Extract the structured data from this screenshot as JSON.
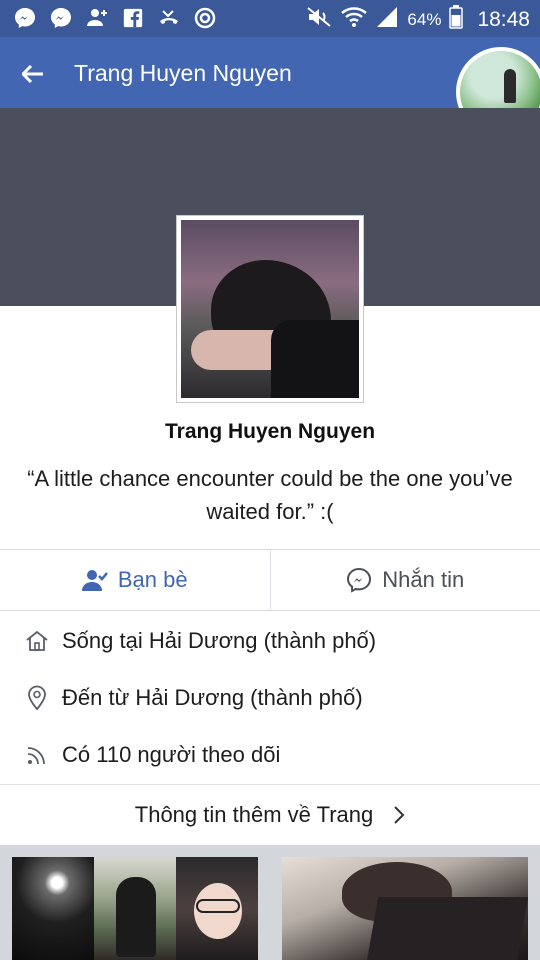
{
  "status_bar": {
    "battery_percent": "64%",
    "time": "18:48"
  },
  "app_bar": {
    "title": "Trang Huyen Nguyen"
  },
  "profile": {
    "name": "Trang Huyen Nguyen",
    "bio": "“A little chance encounter could be the one you’ve waited for.” :("
  },
  "actions": {
    "friends_label": "Bạn bè",
    "message_label": "Nhắn tin"
  },
  "info": {
    "lives_in": "Sống tại Hải Dương (thành phố)",
    "from": "Đến từ Hải Dương (thành phố)",
    "followers": "Có 110 người theo dõi"
  },
  "more_info_label": "Thông tin thêm về Trang",
  "colors": {
    "brand_blue": "#4266b2",
    "cover_gray": "#4b4f5c"
  }
}
